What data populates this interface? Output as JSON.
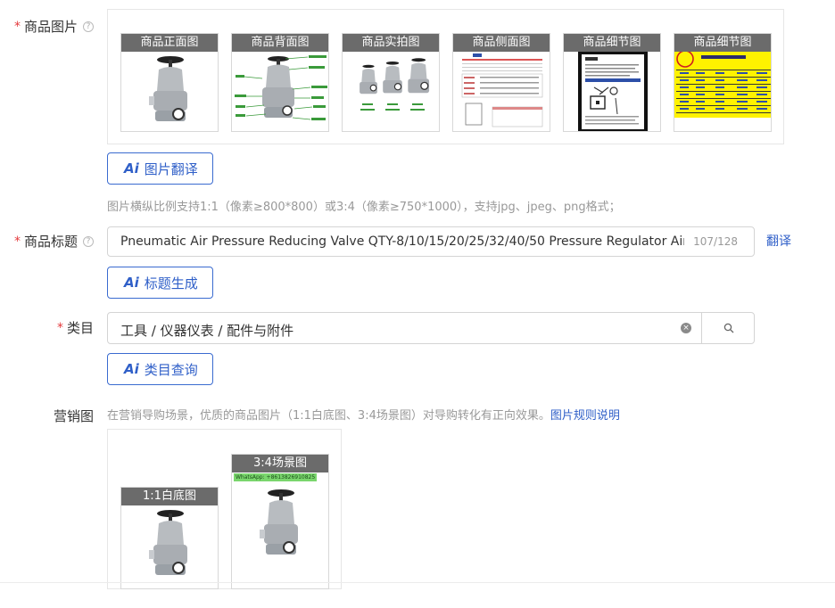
{
  "product_images": {
    "label": "商品图片",
    "help_icon": "question-circle-icon",
    "thumbs": [
      {
        "caption": "商品正面图",
        "kind": "valve"
      },
      {
        "caption": "商品背面图",
        "kind": "diagram"
      },
      {
        "caption": "商品实拍图",
        "kind": "trio"
      },
      {
        "caption": "商品侧面图",
        "kind": "doc"
      },
      {
        "caption": "商品细节图",
        "kind": "phone"
      },
      {
        "caption": "商品细节图",
        "kind": "table"
      }
    ],
    "ai_button": "图片翻译",
    "hint": "图片横纵比例支持1:1（像素≥800*800）或3:4（像素≥750*1000），支持jpg、jpeg、png格式；"
  },
  "product_title": {
    "label": "商品标题",
    "value": "Pneumatic Air Pressure Reducing Valve QTY-8/10/15/20/25/32/40/50 Pressure Regulator Air",
    "count": "107/128",
    "translate": "翻译",
    "ai_button": "标题生成"
  },
  "category": {
    "label": "类目",
    "value": "工具 / 仪器仪表 / 配件与附件",
    "ai_button": "类目查询"
  },
  "marketing": {
    "label": "营销图",
    "hint": "在营销导购场景，优质的商品图片（1:1白底图、3:4场景图）对导购转化有正向效果。",
    "link": "图片规则说明",
    "thumbs": [
      {
        "caption": "1:1白底图"
      },
      {
        "caption": "3:4场景图",
        "tag": "WhatsApp: +8613826910825"
      }
    ]
  },
  "ai_logo": "Ai",
  "colors": {
    "accent": "#2f5fc8",
    "required": "#e4393c",
    "caption_bg": "#6b6b6b"
  }
}
